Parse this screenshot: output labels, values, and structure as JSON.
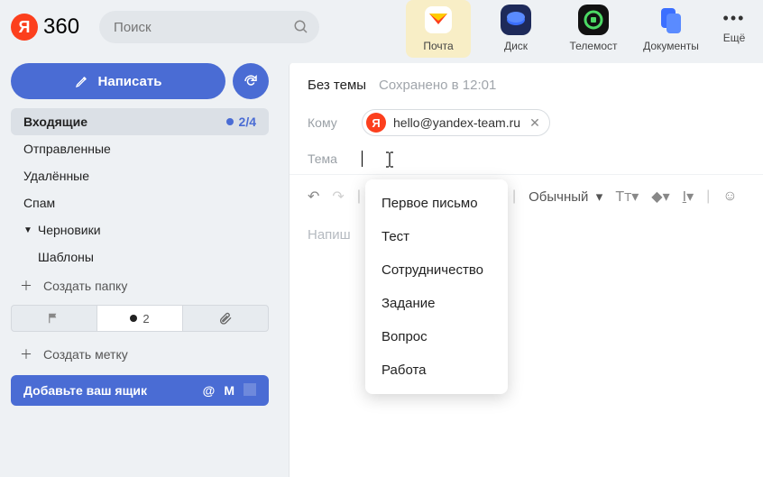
{
  "header": {
    "logo_letter": "Я",
    "logo_text": "360",
    "search_placeholder": "Поиск",
    "apps": [
      {
        "label": "Почта"
      },
      {
        "label": "Диск"
      },
      {
        "label": "Телемост"
      },
      {
        "label": "Документы"
      }
    ],
    "more_label": "Ещё"
  },
  "sidebar": {
    "compose_label": "Написать",
    "folders": {
      "inbox": {
        "label": "Входящие",
        "count": "2/4"
      },
      "sent": {
        "label": "Отправленные"
      },
      "trash": {
        "label": "Удалённые"
      },
      "spam": {
        "label": "Спам"
      },
      "drafts": {
        "label": "Черновики"
      },
      "templates": {
        "label": "Шаблоны"
      }
    },
    "create_folder": "Создать папку",
    "filter_count": "2",
    "create_label": "Создать метку",
    "add_box": "Добавьте ваш ящик"
  },
  "compose": {
    "no_subject": "Без темы",
    "saved": "Сохранено в 12:01",
    "to_label": "Кому",
    "recipient": "hello@yandex-team.ru",
    "theme_label": "Тема",
    "style_label": "Обычный",
    "body_placeholder": "Напиш",
    "suggestions": [
      "Первое письмо",
      "Тест",
      "Сотрудничество",
      "Задание",
      "Вопрос",
      "Работа"
    ]
  }
}
